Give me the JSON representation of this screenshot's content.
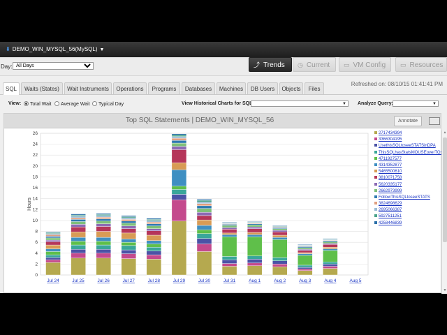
{
  "header": {
    "database": "DEMO_WIN_MYSQL_56(MySQL)"
  },
  "filter": {
    "day_label": "Day:",
    "day_value": "All Days"
  },
  "nav": [
    {
      "label": "Trends",
      "icon": "trend-line-icon",
      "active": true
    },
    {
      "label": "Current",
      "icon": "clock-icon",
      "active": false
    },
    {
      "label": "VM Config",
      "icon": "monitor-icon",
      "active": false
    },
    {
      "label": "Resources",
      "icon": "monitor-icon",
      "active": false
    }
  ],
  "tabs": [
    "SQL",
    "Waits (States)",
    "Wait Instruments",
    "Operations",
    "Programs",
    "Databases",
    "Machines",
    "DB Users",
    "Objects",
    "Files"
  ],
  "active_tab": "SQL",
  "refreshed": "Refreshed on: 08/10/15 01:41:41 PM",
  "view": {
    "label": "View:",
    "options": [
      "Total Wait",
      "Average Wait",
      "Typical Day"
    ],
    "selected": "Total Wait",
    "historical_label": "View Historical Charts for SQL:",
    "historical_value": "",
    "analyze_label": "Analyze Query:",
    "analyze_value": ""
  },
  "panel": {
    "title": "Top SQL Statements | DEMO_WIN_MYSQL_56",
    "annotate": "Annotate"
  },
  "chart_data": {
    "type": "bar",
    "stacked": true,
    "ylabel": "Hours",
    "ylim": [
      0,
      26
    ],
    "yticks": [
      0,
      2,
      4,
      6,
      8,
      10,
      12,
      14,
      16,
      18,
      20,
      22,
      24,
      26
    ],
    "categories": [
      "Jul 24",
      "Jul 25",
      "Jul 26",
      "Jul 27",
      "Jul 28",
      "Jul 29",
      "Jul 30",
      "Jul 31",
      "Aug 1",
      "Aug 2",
      "Aug 3",
      "Aug 4",
      "Aug 5"
    ],
    "grid": true,
    "legend_position": "right",
    "series": [
      {
        "name": "2717434394",
        "color": "#b5a94f",
        "values": [
          2.3,
          3.1,
          3.1,
          3.0,
          2.9,
          9.9,
          4.3,
          1.6,
          1.7,
          1.5,
          0.8,
          1.2,
          0
        ]
      },
      {
        "name": "3366304195",
        "color": "#c44a8d",
        "values": [
          0.5,
          0.9,
          0.9,
          0.9,
          0.8,
          3.9,
          1.4,
          0.5,
          0.5,
          0.5,
          0.3,
          0.4,
          0
        ]
      },
      {
        "name": "UsethisSQLtoseeSTATSinDPA",
        "color": "#4b53a6",
        "values": [
          0.4,
          0.7,
          0.7,
          0.7,
          0.7,
          1.0,
          1.0,
          0.7,
          0.7,
          0.6,
          0.3,
          0.4,
          0
        ]
      },
      {
        "name": "ThisSQLhasStatsMOUSEoverTOsee",
        "color": "#3aa79a",
        "values": [
          0.5,
          0.8,
          0.8,
          0.8,
          0.7,
          0.9,
          0.9,
          0.6,
          0.6,
          0.6,
          0.4,
          0.4,
          0
        ]
      },
      {
        "name": "4711927577",
        "color": "#5fbf4a",
        "values": [
          0.6,
          0.7,
          0.7,
          0.6,
          0.6,
          0.6,
          0.7,
          3.6,
          3.5,
          3.3,
          1.8,
          2.1,
          0
        ]
      },
      {
        "name": "4314352877",
        "color": "#3f8fc2",
        "values": [
          0.5,
          0.7,
          0.7,
          0.6,
          0.6,
          3.0,
          0.8,
          0.4,
          0.4,
          0.4,
          0.3,
          0.3,
          0
        ]
      },
      {
        "name": "5465500610",
        "color": "#d89b55",
        "values": [
          0.7,
          1.0,
          1.1,
          1.1,
          1.0,
          1.3,
          1.0,
          0.3,
          0.4,
          0.4,
          0.2,
          0.3,
          0
        ]
      },
      {
        "name": "3810071758",
        "color": "#b5365a",
        "values": [
          0.6,
          0.9,
          0.9,
          0.8,
          0.8,
          2.4,
          0.8,
          0.7,
          0.7,
          0.6,
          0.4,
          0.5,
          0
        ]
      },
      {
        "name": "5620335177",
        "color": "#8c6bb5",
        "values": [
          0.3,
          0.5,
          0.5,
          0.5,
          0.4,
          0.6,
          0.6,
          0.3,
          0.3,
          0.3,
          0.2,
          0.2,
          0
        ]
      },
      {
        "name": "2662973999",
        "color": "#7fc07a",
        "values": [
          0.4,
          0.5,
          0.5,
          0.5,
          0.5,
          0.6,
          0.7,
          0.4,
          0.4,
          0.3,
          0.3,
          0.3,
          0
        ]
      },
      {
        "name": "FollowThisSQLtoseeSTATS",
        "color": "#2f7ab0",
        "values": [
          0.3,
          0.4,
          0.4,
          0.4,
          0.4,
          0.5,
          0.5,
          0.2,
          0.2,
          0.2,
          0.2,
          0.2,
          0
        ]
      },
      {
        "name": "3824698629",
        "color": "#e0a080",
        "values": [
          0.3,
          0.3,
          0.3,
          0.3,
          0.3,
          0.4,
          0.4,
          0.1,
          0.1,
          0.1,
          0.1,
          0.1,
          0
        ]
      },
      {
        "name": "2695066387",
        "color": "#9bbcd6",
        "values": [
          0.2,
          0.3,
          0.3,
          0.3,
          0.3,
          0.3,
          0.3,
          0.1,
          0.1,
          0.1,
          0.1,
          0.1,
          0
        ]
      },
      {
        "name": "5927511251",
        "color": "#4aa38a",
        "values": [
          0.2,
          0.2,
          0.2,
          0.2,
          0.2,
          0.3,
          0.3,
          0.1,
          0.1,
          0.1,
          0.1,
          0.1,
          0
        ]
      },
      {
        "name": "4258446839",
        "color": "#2a6fa8",
        "values": [
          0.1,
          0.2,
          0.2,
          0.2,
          0.2,
          0.2,
          0.2,
          0.1,
          0.1,
          0.1,
          0.1,
          0.1,
          0
        ]
      }
    ]
  }
}
